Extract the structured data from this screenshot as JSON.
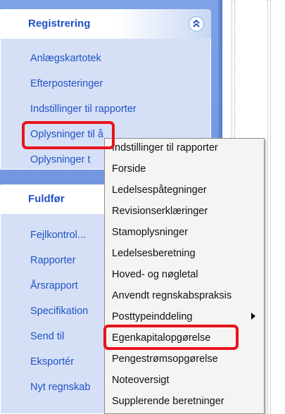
{
  "task_pane": {
    "registrering": {
      "title": "Registrering",
      "links": [
        "Anlægskartotek",
        "Efterposteringer",
        "Indstillinger til rapporter",
        "Oplysninger til å",
        "Oplysninger t"
      ]
    },
    "fuldfor": {
      "title": "Fuldfør",
      "links": [
        "Fejlkontrol...",
        "Rapporter",
        "Årsrapport",
        "Specifikation",
        "Send til",
        "Eksportér",
        "Nyt regnskab"
      ]
    }
  },
  "context_menu": {
    "items": [
      "Indstillinger til rapporter",
      "Forside",
      "Ledelsespåtegninger",
      "Revisionserklæringer",
      "Stamoplysninger",
      "Ledelsesberetning",
      "Hoved- og nøgletal",
      "Anvendt regnskabspraksis",
      "Posttypeinddeling",
      "Egenkapitalopgørelse",
      "Pengestrømsopgørelse",
      "Noteoversigt",
      "Supplerende beretninger"
    ],
    "submenu_item": "Posttypeinddeling",
    "highlighted_item": "Egenkapitalopgørelse"
  },
  "colors": {
    "pane_background": "#7ea2e6",
    "group_body": "#d5e0f7",
    "link_text": "#2152c4",
    "highlight_border": "#e8141c",
    "menu_background": "#f4f4f2"
  },
  "icons": {
    "collapse": "double-chevron-up-icon",
    "submenu": "triangle-right-icon"
  }
}
